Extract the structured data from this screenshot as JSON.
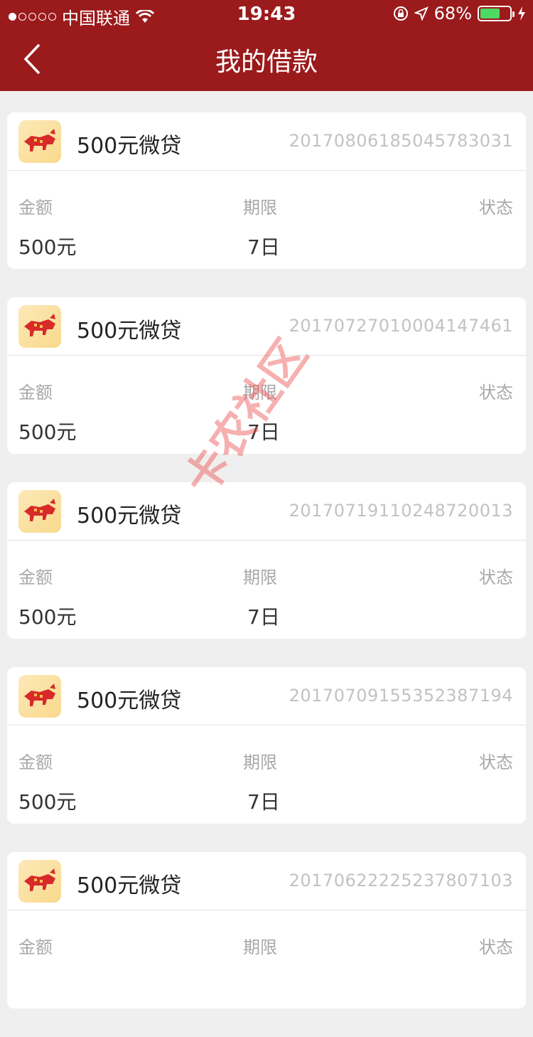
{
  "status_bar": {
    "carrier": "中国联通",
    "time": "19:43",
    "battery": "68%",
    "battery_level": 0.68
  },
  "nav": {
    "title": "我的借款"
  },
  "labels": {
    "amount": "金额",
    "term": "期限",
    "status": "状态"
  },
  "loans": [
    {
      "name": "500元微贷",
      "order_no": "20170806185045783031",
      "amount": "500元",
      "term": "7日",
      "status": ""
    },
    {
      "name": "500元微贷",
      "order_no": "20170727010004147461",
      "amount": "500元",
      "term": "7日",
      "status": ""
    },
    {
      "name": "500元微贷",
      "order_no": "20170719110248720013",
      "amount": "500元",
      "term": "7日",
      "status": ""
    },
    {
      "name": "500元微贷",
      "order_no": "20170709155352387194",
      "amount": "500元",
      "term": "7日",
      "status": ""
    },
    {
      "name": "500元微贷",
      "order_no": "20170622225237807103",
      "amount": "",
      "term": "",
      "status": ""
    }
  ],
  "watermark": "卡农社区",
  "colors": {
    "header": "#9b1a1c",
    "background": "#efefef",
    "card": "#ffffff"
  }
}
